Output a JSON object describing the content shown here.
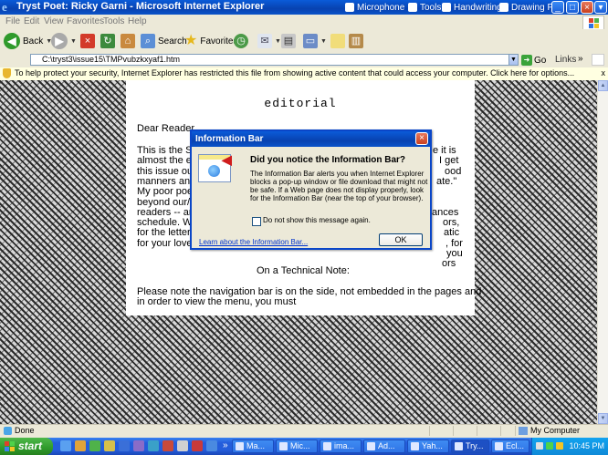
{
  "window": {
    "title": "Tryst Poet: Ricky Garni - Microsoft Internet Explorer",
    "language_bar": [
      "Microphone",
      "Tools",
      "Handwriting",
      "Drawing Pad"
    ]
  },
  "menu": [
    "File",
    "Edit",
    "View",
    "Favorites",
    "Tools",
    "Help"
  ],
  "toolbar": {
    "back": "Back",
    "search": "Search",
    "favorites": "Favorites"
  },
  "address": {
    "url": "C:\\tryst3\\issue15\\TMPvubzkxyaf1.htm",
    "go": "Go",
    "links": "Links"
  },
  "infobar": {
    "message": "To help protect your security, Internet Explorer has restricted this file from showing active content that could access your computer. Click here for options...",
    "close": "x"
  },
  "page": {
    "heading": "editorial",
    "lines": [
      "Dear Reader",
      "This is the Sp",
      "almost the en",
      "this issue out",
      "manners and",
      "My poor poe",
      "beyond our/m",
      "readers -- an",
      "schedule. We",
      "for the letters of",
      "for your lovel"
    ],
    "right_fragments": [
      "e it is",
      "I get",
      "ood",
      "ate.\"",
      "ances",
      "ors,",
      "atic",
      ", for",
      "you",
      "ors"
    ],
    "tech_heading": "On a Technical Note:",
    "tech_body": [
      "Please note the navigation bar is on the side, not embedded in the pages and",
      "in order to view the menu, you must"
    ]
  },
  "dialog": {
    "title": "Information Bar",
    "heading": "Did you notice the Information Bar?",
    "body": "The Information Bar alerts you when Internet Explorer blocks a pop-up window or file download that might not be safe. If a Web page does not display properly, look for the Information Bar (near the top of your browser).",
    "checkbox": "Do not show this message again.",
    "checkbox_checked": false,
    "learn": "Learn about the Information Bar...",
    "ok": "OK"
  },
  "status": {
    "text": "Done",
    "zone": "My Computer"
  },
  "taskbar": {
    "start": "start",
    "tasks": [
      "Ma...",
      "Mic...",
      "ima...",
      "Ad...",
      "Yah...",
      "Try...",
      "Ecl..."
    ],
    "clock": "10:45 PM"
  }
}
